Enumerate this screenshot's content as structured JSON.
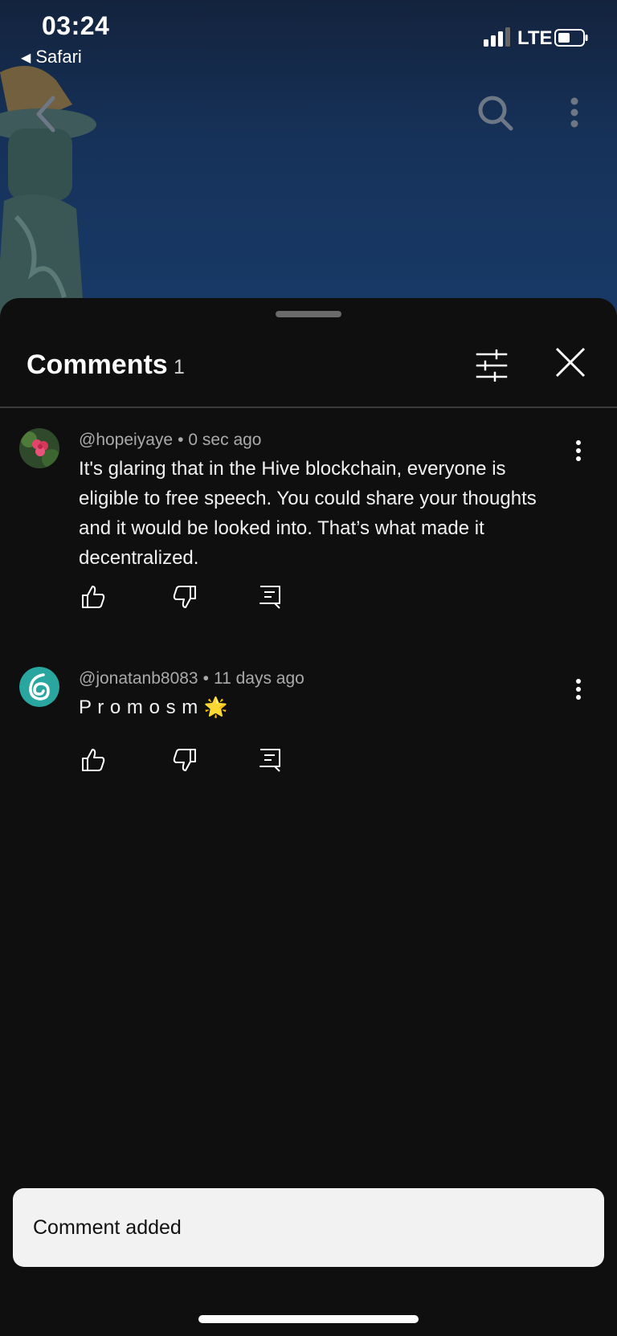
{
  "status_bar": {
    "time": "03:24",
    "back_app": "Safari",
    "back_arrow": "◀",
    "network": "LTE"
  },
  "player": {
    "icons": [
      "back-chevron-icon",
      "search-icon",
      "more-vert-icon"
    ]
  },
  "comments_sheet": {
    "title": "Comments",
    "count": "1",
    "icons": [
      "filter-icon",
      "close-icon"
    ],
    "comments": [
      {
        "author": "@hopeiyaye",
        "separator": "•",
        "time": "0 sec ago",
        "text": "It's glaring that in the Hive blockchain, everyone is eligible to free speech. You could share your thoughts and it would be looked into. That’s what made it decentralized."
      },
      {
        "author": "@jonatanb8083",
        "separator": "•",
        "time": "11 days ago",
        "text": "P r o m o s m 🌟"
      }
    ],
    "action_icons": [
      "thumbs-up-icon",
      "thumbs-down-icon",
      "reply-icon"
    ]
  },
  "toast": {
    "message": "Comment added"
  },
  "colors": {
    "sheet_background": "#0f0f0f",
    "toast_background": "#f2f2f2",
    "meta_text": "#aaaaaa"
  }
}
